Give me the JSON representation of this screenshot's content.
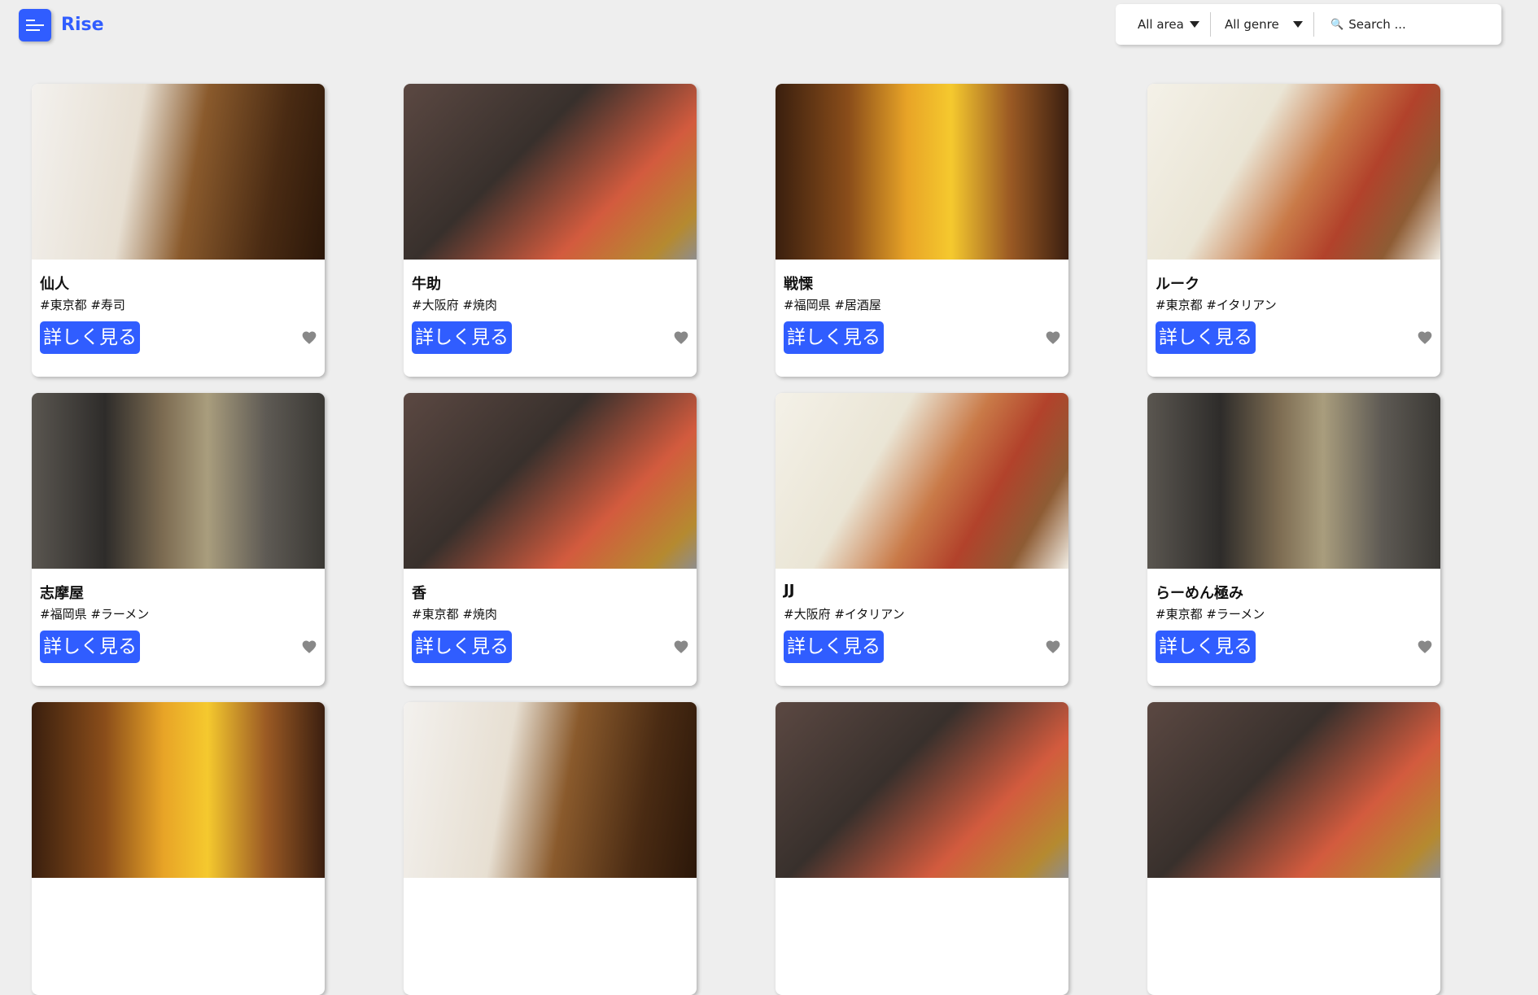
{
  "header": {
    "logo": "Rise",
    "menu_icon": "hamburger-menu-icon"
  },
  "filters": {
    "area": "All area",
    "genre": "All genre",
    "search_placeholder": "Search ...",
    "search_icon": "magnifier-icon"
  },
  "cards": [
    {
      "name": "仙人",
      "tags": "#東京都 #寿司",
      "button": "詳しく見る",
      "image": "sushi"
    },
    {
      "name": "牛助",
      "tags": "#大阪府 #焼肉",
      "button": "詳しく見る",
      "image": "meat"
    },
    {
      "name": "戦慄",
      "tags": "#福岡県 #居酒屋",
      "button": "詳しく見る",
      "image": "izakaya"
    },
    {
      "name": "ルーク",
      "tags": "#東京都 #イタリアン",
      "button": "詳しく見る",
      "image": "pizza"
    },
    {
      "name": "志摩屋",
      "tags": "#福岡県 #ラーメン",
      "button": "詳しく見る",
      "image": "ramen"
    },
    {
      "name": "香",
      "tags": "#東京都 #焼肉",
      "button": "詳しく見る",
      "image": "meat"
    },
    {
      "name": "JJ",
      "tags": "#大阪府 #イタリアン",
      "button": "詳しく見る",
      "image": "pizza"
    },
    {
      "name": "らーめん極み",
      "tags": "#東京都 #ラーメン",
      "button": "詳しく見る",
      "image": "ramen"
    },
    {
      "name": "",
      "tags": "",
      "button": "",
      "image": "izakaya"
    },
    {
      "name": "",
      "tags": "",
      "button": "",
      "image": "sushi"
    },
    {
      "name": "",
      "tags": "",
      "button": "",
      "image": "meat"
    },
    {
      "name": "",
      "tags": "",
      "button": "",
      "image": "meat"
    }
  ],
  "colors": {
    "accent": "#305dff",
    "background": "#eeeeee",
    "heart": "#888888"
  }
}
